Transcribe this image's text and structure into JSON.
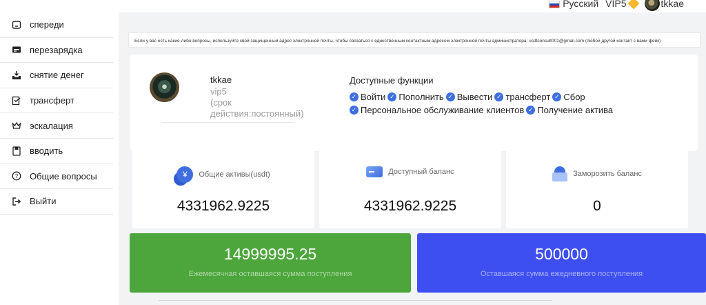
{
  "topbar": {
    "language": "Русский",
    "vip_level": "VIP5",
    "username": "tkkae"
  },
  "sidebar": {
    "items": [
      {
        "label": "спереди",
        "icon": "home-icon"
      },
      {
        "label": "перезарядка",
        "icon": "recharge-icon"
      },
      {
        "label": "снятие денег",
        "icon": "withdraw-icon"
      },
      {
        "label": "трансферт",
        "icon": "transfer-icon"
      },
      {
        "label": "эскалация",
        "icon": "crown-icon"
      },
      {
        "label": "вводить",
        "icon": "document-icon"
      },
      {
        "label": "Общие вопросы",
        "icon": "help-icon"
      },
      {
        "label": "Выйти",
        "icon": "logout-icon"
      }
    ]
  },
  "notice": "Если у вас есть какие-либо вопросы, используйте свой защищенный адрес электронной почты, чтобы связаться с единственным контактным адресом электронной почты администратора: usdtconsult001@gmail.com (любой другой контакт с вами фейк)",
  "profile": {
    "name": "tkkae",
    "vip": "vip5",
    "term": "(срок действия:постоянный)",
    "features_title": "Доступные функции",
    "features": [
      "Войти",
      "Пополнить",
      "Вывести",
      "трансферт",
      "Сбор",
      "Персональное обслуживание клиентов",
      "Получение актива"
    ]
  },
  "stats": [
    {
      "label": "Общие активы(usdt)",
      "value": "4331962.9225",
      "icon": "coin-icon"
    },
    {
      "label": "Доступный баланс",
      "value": "4331962.9225",
      "icon": "card-icon"
    },
    {
      "label": "Заморозить баланс",
      "value": "0",
      "icon": "lock-icon"
    }
  ],
  "limits": [
    {
      "value": "14999995.25",
      "label": "Ежемесячная оставшаяся сумма поступления",
      "color": "#4ca63b"
    },
    {
      "value": "500000",
      "label": "Оставшаяся сумма ежедневного поступления",
      "color": "#3d4ff0"
    }
  ]
}
